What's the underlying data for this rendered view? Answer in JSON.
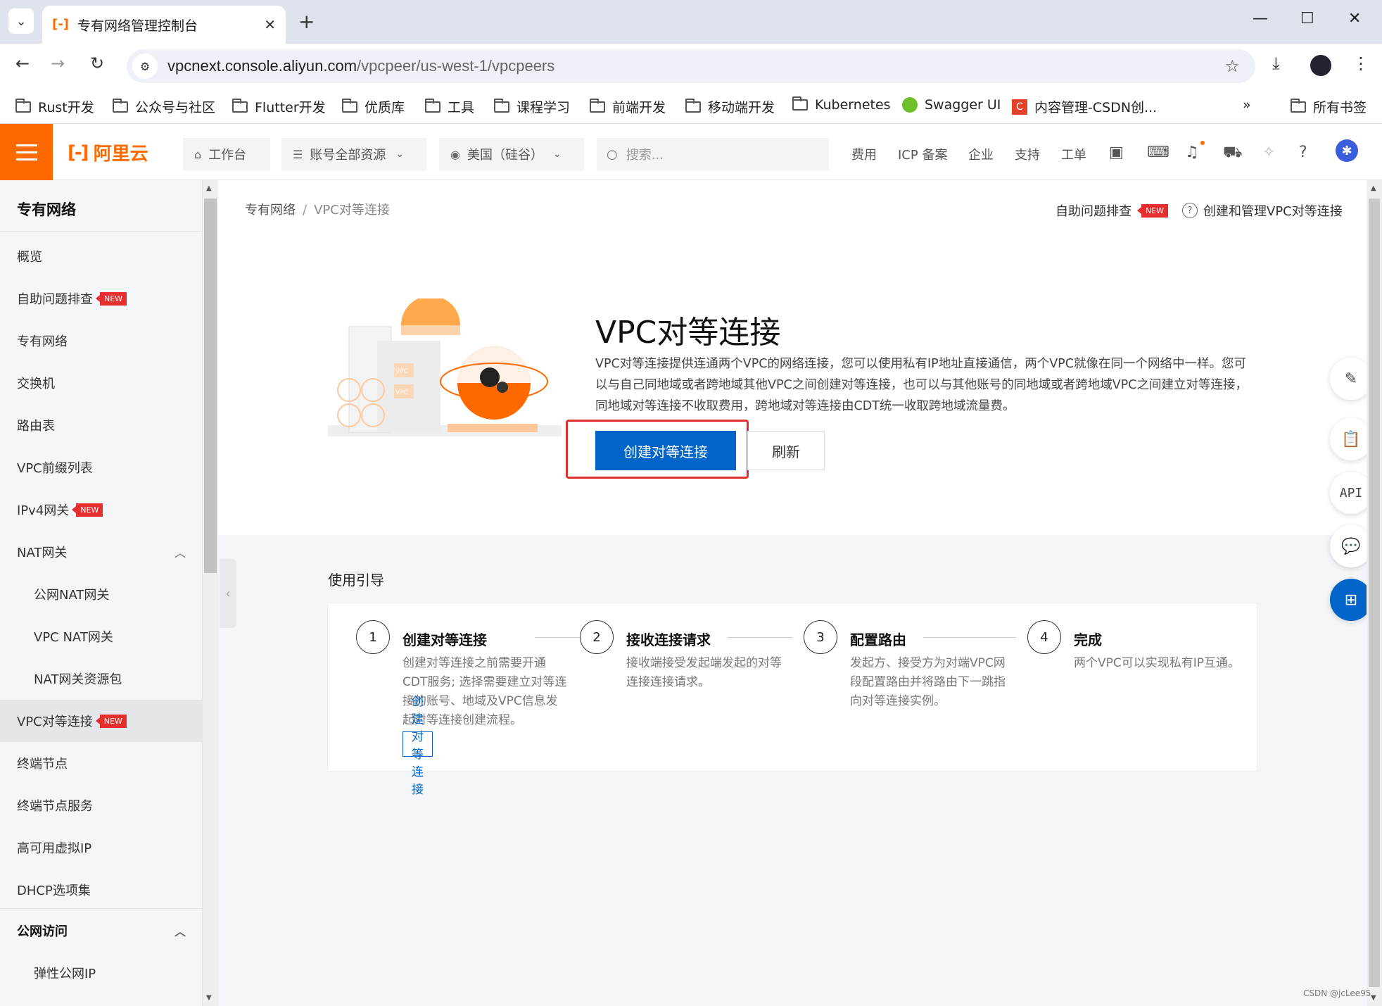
{
  "browser": {
    "tab_title": "专有网络管理控制台",
    "url_host": "vpcnext.console.aliyun.com",
    "url_path": "/vpcpeer/us-west-1/vpcpeers",
    "bookmarks": [
      "Rust开发",
      "公众号与社区",
      "Flutter开发",
      "优质库",
      "工具",
      "课程学习",
      "前端开发",
      "移动端开发",
      "Kubernetes",
      "Swagger UI",
      "内容管理-CSDN创..."
    ],
    "all_bookmarks": "所有书签"
  },
  "console": {
    "logo_text": "阿里云",
    "workbench": "工作台",
    "resources": "账号全部资源",
    "region": "美国（硅谷）",
    "search_placeholder": "搜索...",
    "links": [
      "费用",
      "ICP 备案",
      "企业",
      "支持",
      "工单"
    ]
  },
  "sidebar": {
    "title": "专有网络",
    "badge": "NEW",
    "items": [
      {
        "label": "概览"
      },
      {
        "label": "自助问题排查"
      },
      {
        "label": "专有网络"
      },
      {
        "label": "交换机"
      },
      {
        "label": "路由表"
      },
      {
        "label": "VPC前缀列表"
      },
      {
        "label": "IPv4网关"
      },
      {
        "label": "NAT网关"
      },
      {
        "label": "公网NAT网关"
      },
      {
        "label": "VPC NAT网关"
      },
      {
        "label": "NAT网关资源包"
      },
      {
        "label": "VPC对等连接"
      },
      {
        "label": "终端节点"
      },
      {
        "label": "终端节点服务"
      },
      {
        "label": "高可用虚拟IP"
      },
      {
        "label": "DHCP选项集"
      },
      {
        "label": "公网访问"
      },
      {
        "label": "弹性公网IP"
      }
    ]
  },
  "main": {
    "breadcrumb": [
      "专有网络",
      "VPC对等连接"
    ],
    "self_help": "自助问题排查",
    "help_link": "创建和管理VPC对等连接",
    "hero_title": "VPC对等连接",
    "hero_desc": "VPC对等连接提供连通两个VPC的网络连接，您可以使用私有IP地址直接通信，两个VPC就像在同一个网络中一样。您可以与自己同地域或者跨地域其他VPC之间创建对等连接，也可以与其他账号的同地域或者跨地域VPC之间建立对等连接，同地域对等连接不收取费用，跨地域对等连接由CDT统一收取跨地域流量费。",
    "create_button": "创建对等连接",
    "refresh_button": "刷新",
    "illus_label": "VPC",
    "guide_label": "使用引导",
    "steps": [
      {
        "num": "1",
        "title": "创建对等连接",
        "desc": "创建对等连接之前需要开通CDT服务; 选择需要建立对等连接的账号、地域及VPC信息发起对等连接创建流程。",
        "button": "创建对等连接"
      },
      {
        "num": "2",
        "title": "接收连接请求",
        "desc": "接收端接受发起端发起的对等连接连接请求。"
      },
      {
        "num": "3",
        "title": "配置路由",
        "desc": "发起方、接受方为对端VPC网段配置路由并将路由下一跳指向对等连接实例。"
      },
      {
        "num": "4",
        "title": "完成",
        "desc": "两个VPC可以实现私有IP互通。"
      }
    ]
  },
  "float_toolbar": {
    "api_label": "API"
  },
  "watermark": "CSDN @jcLee95"
}
